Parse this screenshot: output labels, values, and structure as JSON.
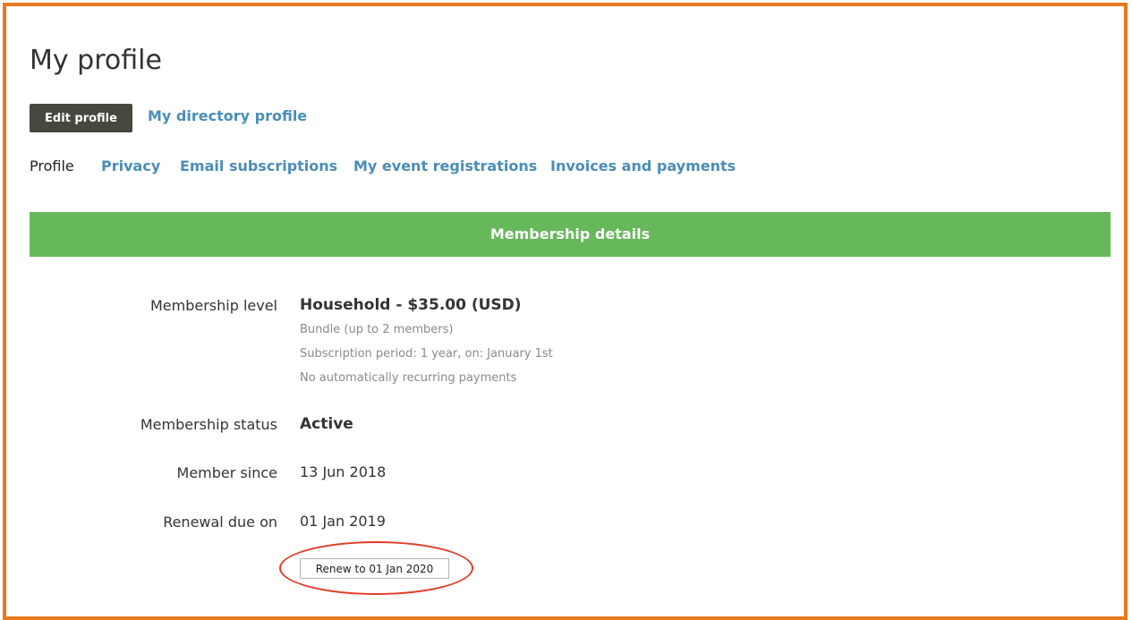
{
  "page": {
    "title": "My profile"
  },
  "actions": {
    "edit_profile": "Edit profile",
    "directory_profile": "My directory profile"
  },
  "tabs": [
    {
      "label": "Profile",
      "current": true
    },
    {
      "label": "Privacy"
    },
    {
      "label": "Email subscriptions"
    },
    {
      "label": "My event registrations"
    },
    {
      "label": "Invoices and payments"
    }
  ],
  "section": {
    "title": "Membership details"
  },
  "membership": {
    "level": {
      "label": "Membership level",
      "value": "Household - $35.00 (USD)",
      "details": [
        "Bundle (up to 2 members)",
        "Subscription period: 1 year, on: January 1st",
        "No automatically recurring payments"
      ]
    },
    "status": {
      "label": "Membership status",
      "value": "Active"
    },
    "since": {
      "label": "Member since",
      "value": "13 Jun 2018"
    },
    "renewal": {
      "label": "Renewal due on",
      "value": "01 Jan 2019"
    },
    "renew_button": "Renew to 01 Jan 2020"
  },
  "colors": {
    "frame": "#e8791d",
    "banner": "#66b85b",
    "link": "#4a8db7",
    "button_dark": "#47463f",
    "annotation": "#e03b2a"
  }
}
